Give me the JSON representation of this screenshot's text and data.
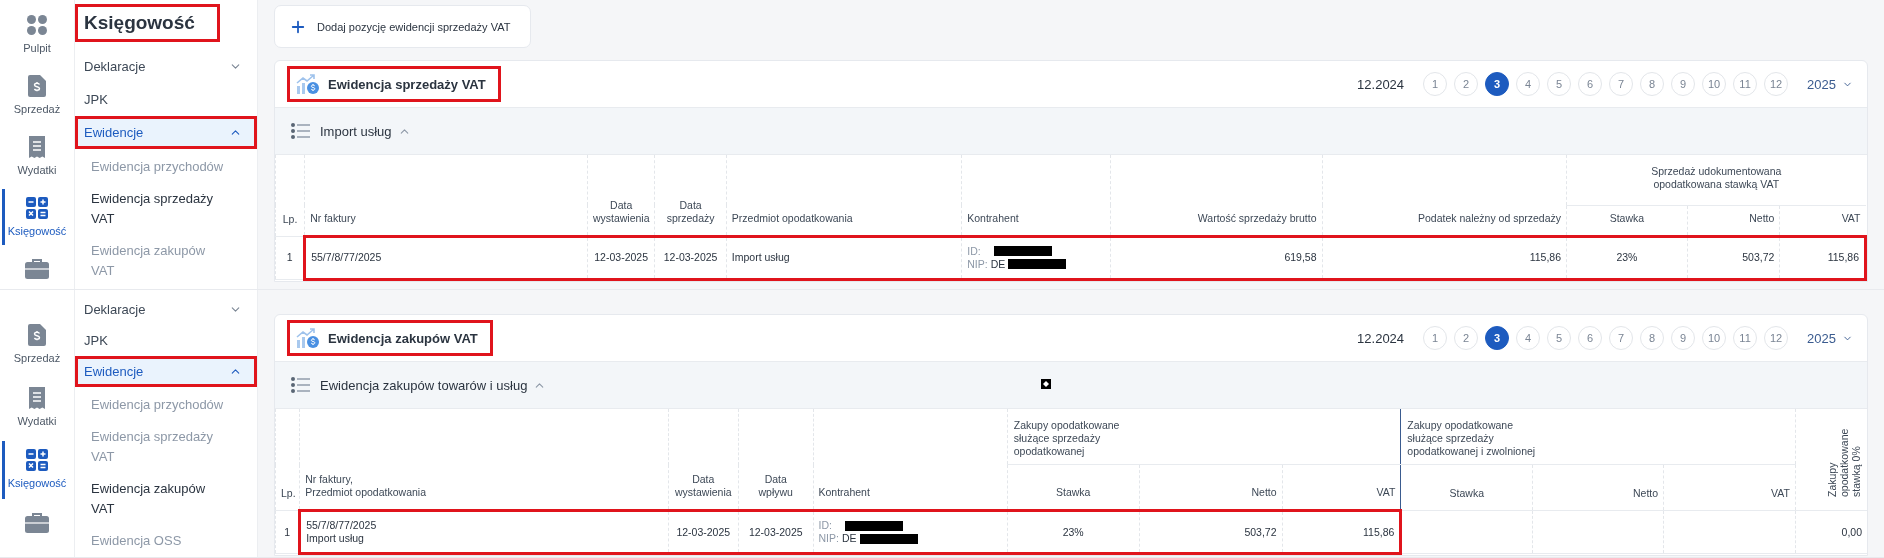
{
  "screens": [
    {
      "rail": [
        {
          "label": "Pulpit",
          "selected": false
        },
        {
          "label": "Sprzedaż",
          "selected": false
        },
        {
          "label": "Wydatki",
          "selected": false
        },
        {
          "label": "Księgowość",
          "selected": true
        },
        {
          "selected": false
        }
      ],
      "menu": {
        "title": "Księgowość",
        "title_highlighted": true,
        "items": [
          {
            "label": "Deklaracje",
            "expanded": false,
            "selected": false,
            "highlighted": false
          },
          {
            "label": "JPK",
            "selected": false,
            "highlighted": false
          },
          {
            "label": "Ewidencje",
            "expanded": true,
            "selected": true,
            "highlighted": true,
            "children": [
              {
                "label": "Ewidencja przychodów",
                "selected": false
              },
              {
                "label": "Ewidencja sprzedaży VAT",
                "selected": true
              },
              {
                "label": "Ewidencja zakupów VAT",
                "selected": false
              }
            ]
          }
        ]
      },
      "add_button": {
        "label": "Dodaj pozycję ewidencji sprzedaży VAT"
      },
      "card": {
        "title": "Ewidencja sprzedaży VAT",
        "title_highlighted": true,
        "period": "12.2024",
        "months": [
          {
            "label": "1",
            "selected": false
          },
          {
            "label": "2",
            "selected": false
          },
          {
            "label": "3",
            "selected": true
          },
          {
            "label": "4",
            "selected": false
          },
          {
            "label": "5",
            "selected": false
          },
          {
            "label": "6",
            "selected": false
          },
          {
            "label": "7",
            "selected": false
          },
          {
            "label": "8",
            "selected": false
          },
          {
            "label": "9",
            "selected": false
          },
          {
            "label": "10",
            "selected": false
          },
          {
            "label": "11",
            "selected": false
          },
          {
            "label": "12",
            "selected": false
          }
        ],
        "year": "2025",
        "section": {
          "label": "Import usług",
          "expanded": true
        },
        "table": {
          "columns": [
            {
              "label": "Lp.",
              "kind": "index"
            },
            {
              "label": "Nr faktury",
              "kind": "text"
            },
            {
              "label": "Data\nwystawienia",
              "kind": "date"
            },
            {
              "label": "Data\nsprzedaży",
              "kind": "date"
            },
            {
              "label": "Przedmiot opodatkowania",
              "kind": "text"
            },
            {
              "label": "Kontrahent",
              "kind": "party"
            },
            {
              "label": "Wartość sprzedaży brutto",
              "kind": "amount"
            },
            {
              "label": "Podatek należny od sprzedaży",
              "kind": "amount"
            },
            {
              "label": "Sprzedaż udokumentowana\nopodatkowana stawką VAT",
              "kind": "centered",
              "colspan": 3,
              "children": [
                {
                  "label": "Stawka",
                  "kind": "rate"
                },
                {
                  "label": "Netto",
                  "kind": "amount"
                },
                {
                  "label": "VAT",
                  "kind": "amount"
                }
              ]
            }
          ],
          "rows": [
            {
              "cells": [
                {
                  "text": "1",
                  "highlighted": false
                },
                {
                  "text": "55/7/8/77/2025",
                  "highlighted": true
                },
                {
                  "text": "12-03-2025",
                  "highlighted": true
                },
                {
                  "text": "12-03-2025",
                  "highlighted": true
                },
                {
                  "text": "Import usług",
                  "highlighted": true
                },
                {
                  "id_label": "ID:",
                  "nip_label": "NIP:",
                  "nip_value": "DE",
                  "highlighted": true
                },
                {
                  "text": "619,58",
                  "highlighted": true
                },
                {
                  "text": "115,86",
                  "highlighted": true
                },
                {
                  "text": "23%",
                  "highlighted": true
                },
                {
                  "text": "503,72",
                  "highlighted": true
                },
                {
                  "text": "115,86",
                  "highlighted": true
                }
              ]
            }
          ]
        }
      }
    },
    {
      "rail": [
        {
          "label": "Sprzedaż",
          "selected": false
        },
        {
          "label": "Wydatki",
          "selected": false
        },
        {
          "label": "Księgowość",
          "selected": true
        },
        {
          "selected": false
        }
      ],
      "menu": {
        "items": [
          {
            "label": "Deklaracje",
            "expanded": false,
            "selected": false,
            "highlighted": false
          },
          {
            "label": "JPK",
            "selected": false,
            "highlighted": false
          },
          {
            "label": "Ewidencje",
            "expanded": true,
            "selected": true,
            "highlighted": true,
            "children": [
              {
                "label": "Ewidencja przychodów",
                "selected": false
              },
              {
                "label": "Ewidencja sprzedaży VAT",
                "selected": false
              },
              {
                "label": "Ewidencja zakupów VAT",
                "selected": true
              },
              {
                "label": "Ewidencja OSS",
                "selected": false
              }
            ]
          }
        ]
      },
      "card": {
        "title": "Ewidencja zakupów VAT",
        "title_highlighted": true,
        "period": "12.2024",
        "months": [
          {
            "label": "1",
            "selected": false
          },
          {
            "label": "2",
            "selected": false
          },
          {
            "label": "3",
            "selected": true
          },
          {
            "label": "4",
            "selected": false
          },
          {
            "label": "5",
            "selected": false
          },
          {
            "label": "6",
            "selected": false
          },
          {
            "label": "7",
            "selected": false
          },
          {
            "label": "8",
            "selected": false
          },
          {
            "label": "9",
            "selected": false
          },
          {
            "label": "10",
            "selected": false
          },
          {
            "label": "11",
            "selected": false
          },
          {
            "label": "12",
            "selected": false
          }
        ],
        "year": "2025",
        "section": {
          "label": "Ewidencja zakupów towarów i usług",
          "expanded": true,
          "marker": true
        },
        "table": {
          "columns": [
            {
              "label": "Lp.",
              "kind": "index"
            },
            {
              "label": "Nr faktury,\nPrzedmiot opodatkowania",
              "kind": "text"
            },
            {
              "label": "Data\nwystawienia",
              "kind": "date"
            },
            {
              "label": "Data\nwpływu",
              "kind": "date"
            },
            {
              "label": "Kontrahent",
              "kind": "party"
            },
            {
              "label": "Zakupy opodatkowane\nsłużące sprzedaży\nopodatkowanej",
              "kind": "plain",
              "colspan": 3,
              "children": [
                {
                  "label": "Stawka",
                  "kind": "rate"
                },
                {
                  "label": "Netto",
                  "kind": "amount"
                },
                {
                  "label": "VAT",
                  "kind": "amount"
                }
              ]
            },
            {
              "label": "Zakupy opodatkowane\nsłużące sprzedaży\nopodatkowanej i zwolnionej",
              "kind": "divided",
              "colspan": 3,
              "children": [
                {
                  "label": "Stawka",
                  "kind": "rate"
                },
                {
                  "label": "Netto",
                  "kind": "amount"
                },
                {
                  "label": "VAT",
                  "kind": "amount"
                }
              ]
            },
            {
              "label": "Zakupy opodatkowane stawką 0%",
              "kind": "vertical"
            }
          ],
          "rows": [
            {
              "cells": [
                {
                  "text": "1",
                  "highlighted": false
                },
                {
                  "text": "55/7/8/77/2025\nImport usług",
                  "highlighted": true
                },
                {
                  "text": "12-03-2025",
                  "highlighted": true
                },
                {
                  "text": "12-03-2025",
                  "highlighted": true
                },
                {
                  "id_label": "ID:",
                  "nip_label": "NIP:",
                  "nip_value": "DE",
                  "highlighted": true
                },
                {
                  "text": "23%",
                  "highlighted": true
                },
                {
                  "text": "503,72",
                  "highlighted": true
                },
                {
                  "text": "115,86",
                  "highlighted": true
                },
                {
                  "highlighted": false
                },
                {
                  "highlighted": false
                },
                {
                  "highlighted": false
                },
                {
                  "text": "0,00",
                  "highlighted": false
                }
              ]
            }
          ]
        }
      }
    }
  ]
}
